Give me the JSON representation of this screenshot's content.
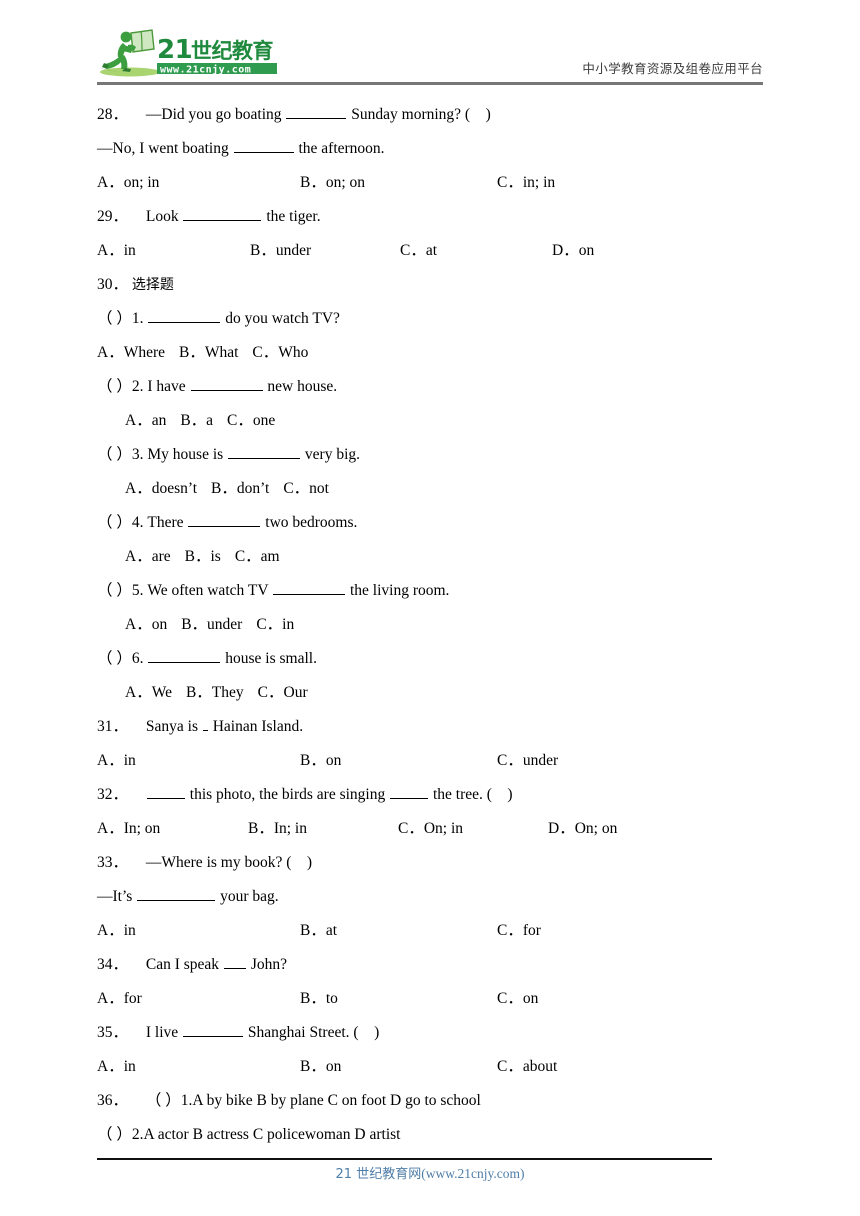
{
  "header": {
    "logo_text_main": "21世纪教育",
    "logo_text_url": "www.21cnjy.com",
    "tagline": "中小学教育资源及组卷应用平台",
    "brand_green": "#2e9b4f",
    "brand_dark_green": "#1f7a3c",
    "rule_color": "#777777"
  },
  "questions": {
    "q28": {
      "num": "28．",
      "stem_a1": "—Did you go boating",
      "stem_a2": "Sunday morning? (",
      "stem_a3": ")",
      "stem_b1": "—No, I went boating",
      "stem_b2": "the afternoon.",
      "optA": "A．on; in",
      "optB": "B．on; on",
      "optC": "C．in; in"
    },
    "q29": {
      "num": "29．",
      "stem_1": "Look",
      "stem_2": "the tiger.",
      "optA": "A．in",
      "optB": "B．under",
      "optC": "C．at",
      "optD": "D．on"
    },
    "q30": {
      "num": "30．",
      "title": "选择题",
      "items": [
        {
          "mark": "（ ）1.",
          "stem_2": "do you watch TV?",
          "optA": "A．Where",
          "optB": "B．What",
          "optC": "C．Who"
        },
        {
          "mark": "（ ）2. I have",
          "stem_2": "new house.",
          "optA": "A．an",
          "optB": "B．a",
          "optC": "C．one"
        },
        {
          "mark": "（ ）3. My house is",
          "stem_2": "very big.",
          "optA": "A．doesn’t",
          "optB": "B．don’t",
          "optC": "C．not"
        },
        {
          "mark": "（ ）4. There",
          "stem_2": "two bedrooms.",
          "optA": "A．are",
          "optB": "B．is",
          "optC": "C．am"
        },
        {
          "mark": "（ ）5. We often watch TV",
          "stem_2": "the living room.",
          "optA": "A．on",
          "optB": "B．under",
          "optC": "C．in"
        },
        {
          "mark": "（ ）6.",
          "stem_2": "house is small.",
          "optA": "A．We",
          "optB": "B．They",
          "optC": "C．Our"
        }
      ]
    },
    "q31": {
      "num": "31．",
      "stem_1": "Sanya is",
      "stem_2": "Hainan Island.",
      "optA": "A．in",
      "optB": "B．on",
      "optC": "C．under"
    },
    "q32": {
      "num": "32．",
      "stem_1": "this photo, the birds are singing",
      "stem_2": "the tree. (",
      "stem_3": ")",
      "optA": "A．In; on",
      "optB": "B．In; in",
      "optC": "C．On; in",
      "optD": "D．On; on"
    },
    "q33": {
      "num": "33．",
      "stem_a1": "—Where is my book? (",
      "stem_a2": ")",
      "stem_b1": "—It’s",
      "stem_b2": "your bag.",
      "optA": "A．in",
      "optB": "B．at",
      "optC": "C．for"
    },
    "q34": {
      "num": "34．",
      "stem_1": "Can I speak",
      "stem_2": "John?",
      "optA": "A．for",
      "optB": "B．to",
      "optC": "C．on"
    },
    "q35": {
      "num": "35．",
      "stem_1": "I live",
      "stem_2": "Shanghai Street. (",
      "stem_3": ")",
      "optA": "A．in",
      "optB": "B．on",
      "optC": "C．about"
    },
    "q36": {
      "num": "36．",
      "line_1": "（ ）1.A by bike B by plane C on foot D go to school",
      "line_2": "（ ）2.A actor B actress C policewoman D artist"
    }
  },
  "footer": {
    "text_cn": "21 世纪教育网",
    "text_url": "(www.21cnjy.com)",
    "color": "#4f7ea8"
  }
}
